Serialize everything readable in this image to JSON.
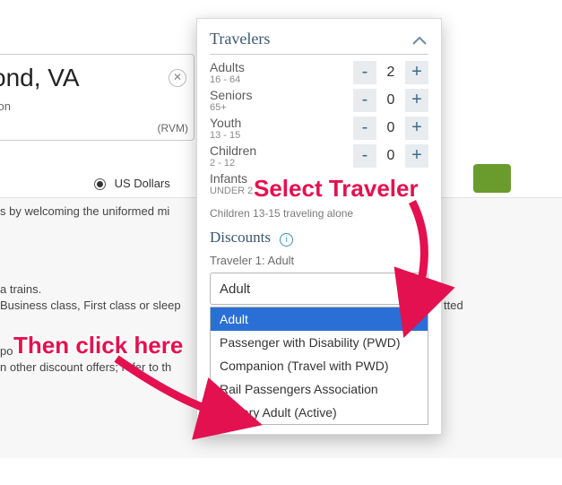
{
  "background": {
    "city": "ond, VA",
    "station_label": "tion",
    "station_code": "(RVM)",
    "usd": "US Dollars",
    "text_line1": "s by welcoming the uniformed mi",
    "text_line2": "a trains.",
    "text_line3": "Business class, First class or sleep",
    "text_line3_tail": "tted",
    "text_line4": "po",
    "text_line5": "n other discount offers; refer to th"
  },
  "panel": {
    "header": "Travelers",
    "rows": [
      {
        "name": "Adults",
        "sub": "16 - 64",
        "value": "2"
      },
      {
        "name": "Seniors",
        "sub": "65+",
        "value": "0"
      },
      {
        "name": "Youth",
        "sub": "13 - 15",
        "value": "0"
      },
      {
        "name": "Children",
        "sub": "2 - 12",
        "value": "0"
      },
      {
        "name": "Infants",
        "sub": "UNDER 2",
        "value": ""
      }
    ],
    "minus": "-",
    "plus": "+",
    "alone": "Children 13-15 traveling alone",
    "discounts": "Discounts",
    "traveler1": "Traveler 1: Adult",
    "selected": "Adult",
    "options": [
      "Adult",
      "Passenger with Disability (PWD)",
      "Companion (Travel with PWD)",
      "Rail Passengers Association",
      "Military Adult (Active)"
    ]
  },
  "anno1": "Select Traveler",
  "anno2": "Then click here"
}
